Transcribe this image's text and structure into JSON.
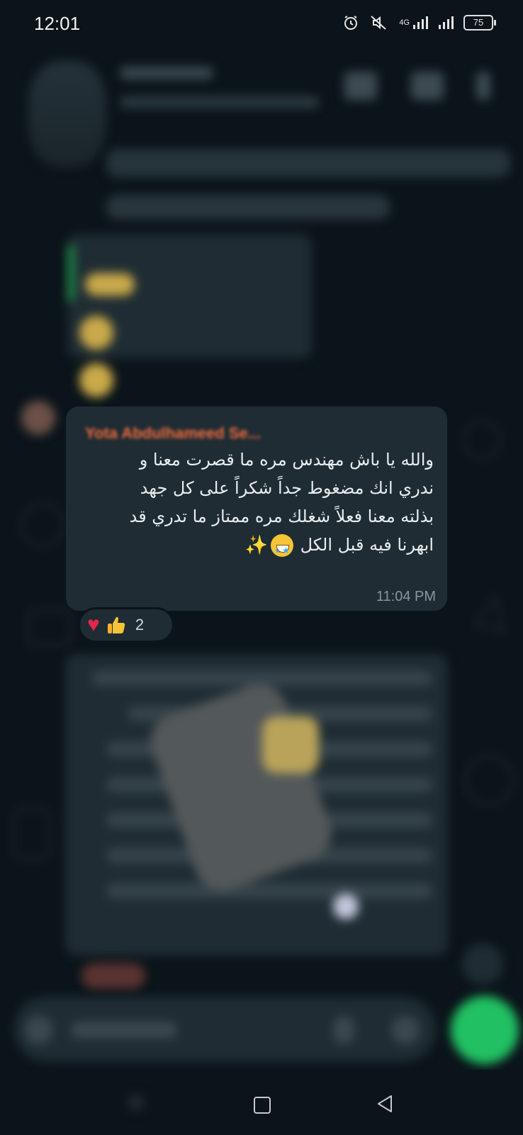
{
  "status_bar": {
    "time": "12:01",
    "battery": "75",
    "network": "4G"
  },
  "message": {
    "sender": "Yota Abdulhameed Se...",
    "lines": [
      "والله يا باش مهندس مره ما قصرت معنا و",
      "ندري انك مضغوط جداً شكراً على كل جهد",
      "بذلته معنا فعلاً شغلك مره ممتاز ما تدري قد",
      "ابهرنا فيه قبل الكل"
    ],
    "time": "11:04 PM",
    "reactions": {
      "emojis": [
        "heart",
        "thumbs-up"
      ],
      "count": "2"
    }
  },
  "colors": {
    "background": "#0b141a",
    "bubble": "#1f2c33",
    "sender_name": "#ef6b3f",
    "accent_green": "#21c063"
  },
  "icons": [
    "alarm-icon",
    "mute-icon",
    "signal-icon",
    "battery-icon",
    "video-call-icon",
    "voice-call-icon",
    "more-icon",
    "mic-icon",
    "nav-home-icon",
    "nav-back-icon"
  ]
}
